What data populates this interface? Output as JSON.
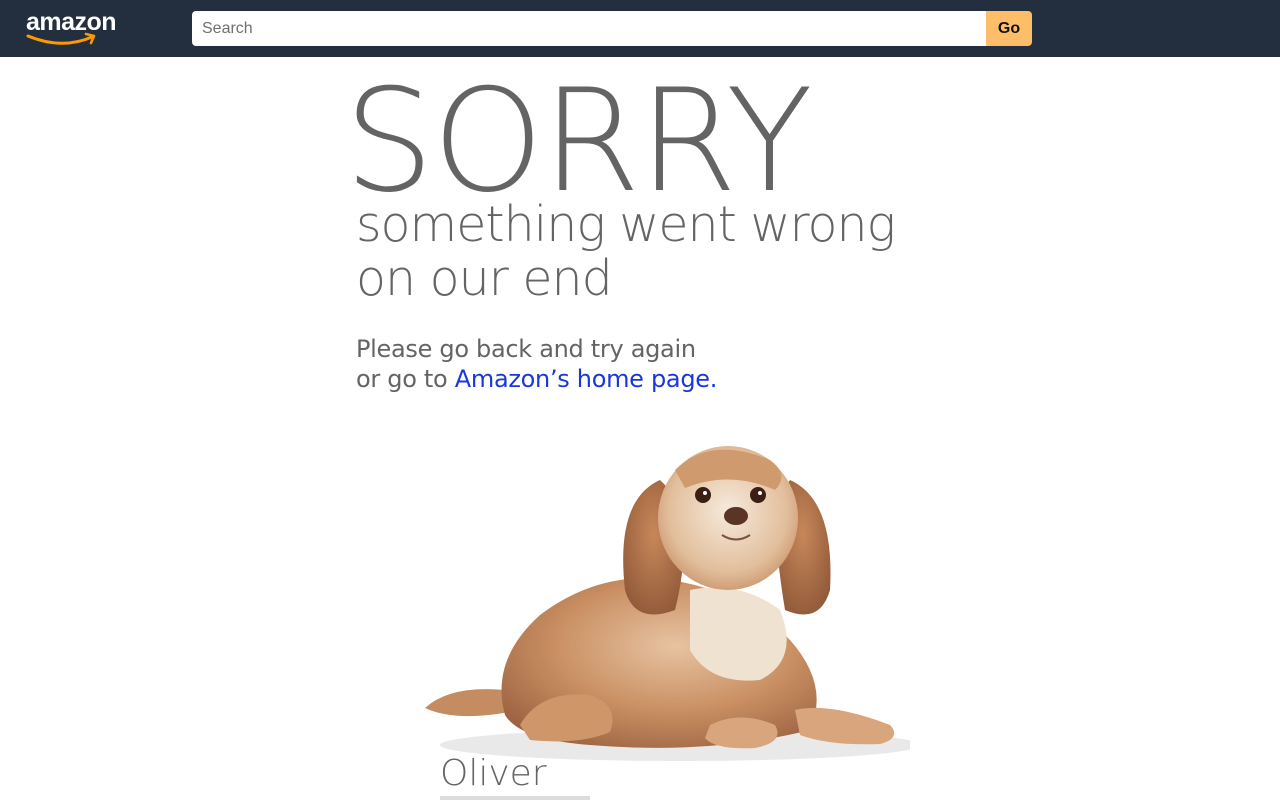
{
  "header": {
    "logo_text": "amazon",
    "search": {
      "placeholder": "Search",
      "value": ""
    },
    "go_label": "Go"
  },
  "main": {
    "headline": "SORRY",
    "subline_1": "something went wrong",
    "subline_2": "on our end",
    "instruction_1": "Please go back and try again",
    "instruction_2_prefix": "or go to ",
    "home_link_label": "Amazon’s home page.",
    "dog_name": "Oliver"
  },
  "colors": {
    "header_bg": "#232f3e",
    "go_button": "#febd69",
    "logo_smile": "#ff9900",
    "link": "#1a38d9",
    "text_gray": "#646464"
  },
  "icons": {
    "logo": "amazon-logo",
    "dog": "dog-photo-icon"
  }
}
